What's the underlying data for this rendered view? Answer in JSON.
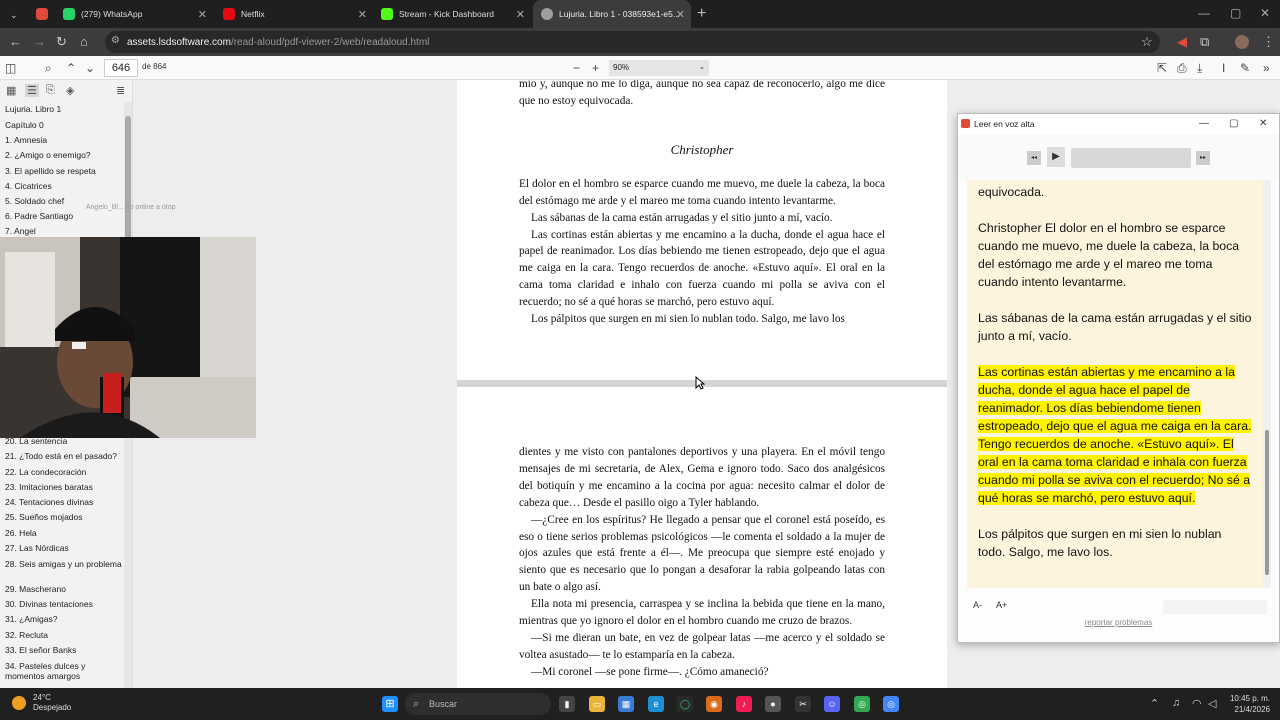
{
  "browser": {
    "tabs": [
      {
        "title": "(279) WhatsApp",
        "color": "#25d366"
      },
      {
        "title": "Netflix",
        "color": "#e50914"
      },
      {
        "title": "Stream - Kick Dashboard",
        "color": "#53fc18"
      },
      {
        "title": "Lujuria. Libro 1 - 038593e1-e5...",
        "color": "#9e9e9e",
        "active": true
      }
    ],
    "url_host": "assets.lsdsoftware.com",
    "url_path": "/read-aloud/pdf-viewer-2/web/readaloud.html",
    "new_tab": "+"
  },
  "pdf": {
    "page_number": "646",
    "page_total": "de 864",
    "zoom": "90%",
    "outline": [
      "Lujuria. Libro 1",
      "Capítulo 0",
      "1. Amnesia",
      "2. ¿Amigo o enemigo?",
      "3. El apellido se respeta",
      "4. Cicatrices",
      "5. Soldado chef",
      "6. Padre Santiago",
      "7. Angel",
      "20. La sentencia",
      "21. ¿Todo está en el pasado?",
      "22. La condecoración",
      "23. Imitaciones baratas",
      "24. Tentaciones divinas",
      "25. Sueños mojados",
      "26. Hela",
      "27. Las Nórdicas",
      "28. Seis amigas y un problema",
      "29. Mascherano",
      "30. Divinas tentaciones",
      "31. ¿Amigas?",
      "32. Recluta",
      "33. El señor Banks",
      "34. Pasteles dulces y momentos amargos"
    ],
    "watermark": "Angelo_Bl... no online a otop",
    "page1": {
      "top_text": "mío y, aunque no me lo diga, aunque no sea capaz de reconocerlo, algo me dice que no estoy equivocada.",
      "chapter": "Christopher",
      "paragraphs": [
        "El dolor en el hombro se esparce cuando me muevo, me duele la cabeza, la boca del estómago me arde y el mareo me toma cuando intento levantarme.",
        "Las sábanas de la cama están arrugadas y el sitio junto a mí, vacío.",
        "Las cortinas están abiertas y me encamino a la ducha, donde el agua hace el papel de reanimador. Los días bebiendo me tienen estropeado, dejo que el agua me caiga en la cara. Tengo recuerdos de anoche. «Estuvo aquí». El oral en la cama toma claridad e inhalo con fuerza cuando mi polla se aviva con el recuerdo; no sé a qué horas se marchó, pero estuvo aquí.",
        "Los pálpitos que surgen en mi sien lo nublan todo. Salgo, me lavo los"
      ]
    },
    "page2": {
      "paragraphs": [
        "dientes y me visto con pantalones deportivos y una playera. En el móvil tengo mensajes de mi secretaria, de Alex, Gema e ignoro todo. Saco dos analgésicos del botiquín y me encamino a la cocina por agua: necesito calmar el dolor de cabeza que… Desde el pasillo oigo a Tyler hablando.",
        "—¿Cree en los espíritus? He llegado a pensar que el coronel está poseído, es eso o tiene serios problemas psicológicos —le comenta el soldado a la mujer de ojos azules que está frente a él—. Me preocupa que siempre esté enojado y siento que es necesario que lo pongan a desaforar la rabia golpeando latas con un bate o algo así.",
        "Ella nota mi presencia, carraspea y se inclina la bebida que tiene en la mano, mientras que yo ignoro el dolor en el hombro cuando me cruzo de brazos.",
        "—Si me dieran un bate, en vez de golpear latas —me acerco y el soldado se voltea asustado— te lo estamparía en la cabeza.",
        "—Mi coronel —se pone firme—. ¿Cómo amaneció?"
      ]
    }
  },
  "readaloud": {
    "title": "Leer en voz alta",
    "partial_top": "equivocada.",
    "paragraphs": [
      "Christopher El dolor en el hombro se esparce cuando me muevo, me duele la cabeza, la boca del estómago me arde y el mareo me toma cuando intento levantarme.",
      "Las sábanas de la cama están arrugadas y el sitio junto a mí, vacío."
    ],
    "highlighted": "Las cortinas están abiertas y me encamino a la ducha, donde el agua hace el papel de reanimador. Los días bebiendome tienen estropeado, dejo que el agua me caiga en la cara. Tengo recuerdos de anoche. «Estuvo aquí». El oral en la cama toma claridad e inhala con fuerza cuando mi polla se aviva con el recuerdo; No sé a qué horas se marchó, pero estuvo aquí.",
    "last": "Los pálpitos que surgen en mi sien lo nublan todo. Salgo, me lavo los.",
    "font_down": "A-",
    "font_up": "A+",
    "report": "reportar problemas",
    "highlight_color": "#fff200"
  },
  "taskbar": {
    "temperature": "24°C",
    "weather": "Despejado",
    "search": "Buscar",
    "time": "10:45 p. m.",
    "date": "21/4/2026"
  }
}
